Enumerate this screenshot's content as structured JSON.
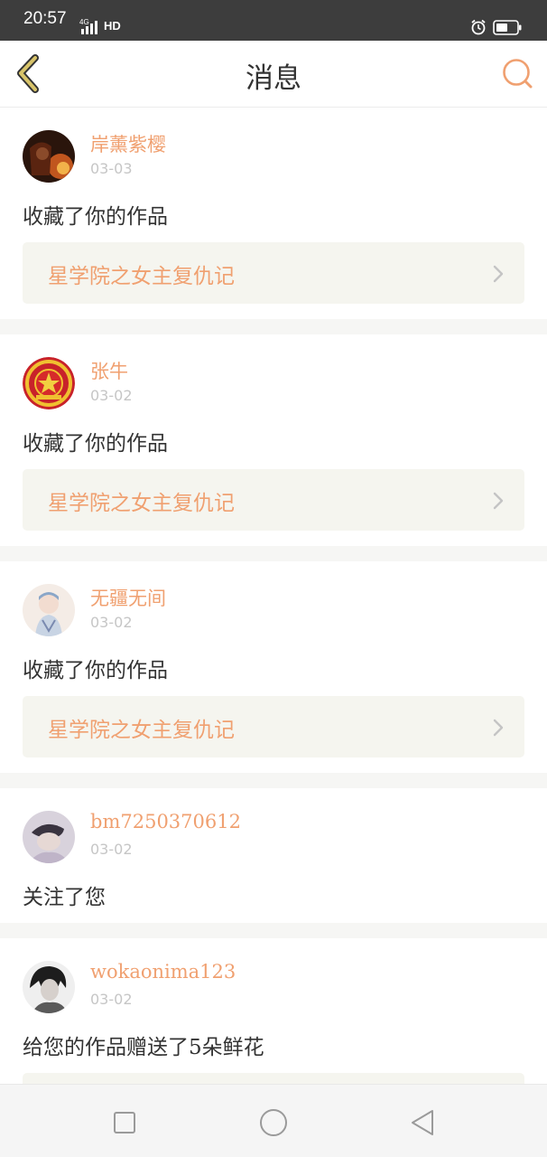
{
  "status_bar": {
    "time": "20:57",
    "network": "4G",
    "hd_label": "HD",
    "icons": [
      "signal-icon",
      "alarm-icon",
      "battery-icon"
    ]
  },
  "header": {
    "title": "消息",
    "back_icon": "back-chevron-icon",
    "search_icon": "search-icon"
  },
  "colors": {
    "accent": "#f0a070",
    "header_back": "#d8c46a",
    "status_bar_bg": "#3d3d3d",
    "card_inner_bg": "#f5f5ef"
  },
  "messages": [
    {
      "username": "岸薰紫樱",
      "date": "03-03",
      "action": "收藏了你的作品",
      "work_title": "星学院之女主复仇记"
    },
    {
      "username": "张牛",
      "date": "03-02",
      "action": "收藏了你的作品",
      "work_title": "星学院之女主复仇记"
    },
    {
      "username": "无疆无间",
      "date": "03-02",
      "action": "收藏了你的作品",
      "work_title": "星学院之女主复仇记"
    },
    {
      "username": "bm7250370612",
      "date": "03-02",
      "action": "关注了您"
    },
    {
      "username": "wokaonima123",
      "date": "03-02",
      "action": "给您的作品赠送了5朵鲜花"
    }
  ],
  "system_nav": {
    "icons": [
      "recent-apps-icon",
      "home-icon",
      "back-icon"
    ]
  }
}
